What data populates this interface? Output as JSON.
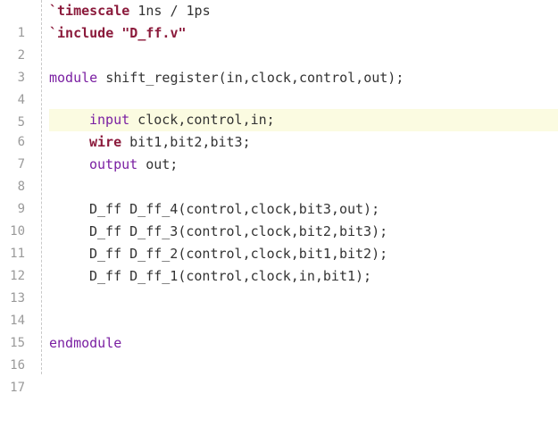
{
  "editor": {
    "lines": [
      {
        "n": "1"
      },
      {
        "n": "2"
      },
      {
        "n": "3"
      },
      {
        "n": "4"
      },
      {
        "n": "5"
      },
      {
        "n": "6"
      },
      {
        "n": "7"
      },
      {
        "n": "8"
      },
      {
        "n": "9"
      },
      {
        "n": "10"
      },
      {
        "n": "11"
      },
      {
        "n": "12"
      },
      {
        "n": "13"
      },
      {
        "n": "14"
      },
      {
        "n": "15"
      },
      {
        "n": "16"
      },
      {
        "n": "17"
      }
    ],
    "code": {
      "l1_directive": "`timescale",
      "l1_rest": " 1ns / 1ps",
      "l2_directive": "`include",
      "l2_space": " ",
      "l2_string": "\"D_ff.v\"",
      "l4_kw": "module",
      "l4_rest": " shift_register(in,clock,control,out);",
      "l6_kw": "input",
      "l6_rest": " clock,control,in;",
      "l7_kw": "wire",
      "l7_rest": " bit1,bit2,bit3;",
      "l8_kw": "output",
      "l8_rest": " out;",
      "l10": "D_ff D_ff_4(control,clock,bit3,out);",
      "l11": "D_ff D_ff_3(control,clock,bit2,bit3);",
      "l12": "D_ff D_ff_2(control,clock,bit1,bit2);",
      "l13": "D_ff D_ff_1(control,clock,in,bit1);",
      "l16_kw": "endmodule"
    }
  },
  "colors": {
    "active_line": "#fbfbe1",
    "keyword": "#7a1fa2",
    "directive": "#8b1a3b",
    "line_number": "#9a9a9a"
  }
}
